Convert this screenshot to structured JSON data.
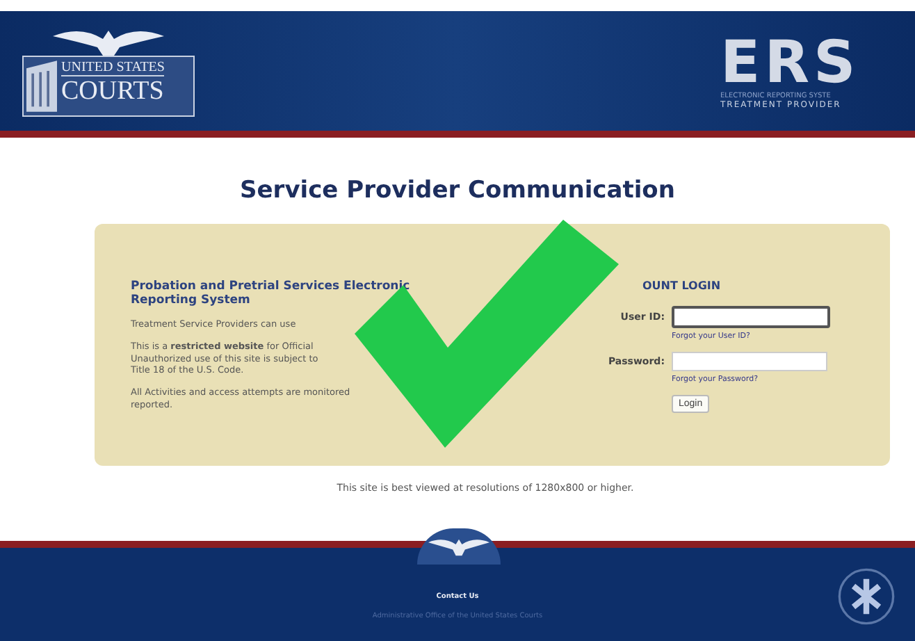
{
  "header": {
    "courts_logo": {
      "line_1": "UNITED STATES",
      "line_2": "COURTS"
    },
    "ers_logo": {
      "mark": "ERS",
      "subtitle_1": "ELECTRONIC REPORTING SYSTE",
      "subtitle_2": "TREATMENT PROVIDER"
    }
  },
  "title": "Service Provider Communication",
  "info": {
    "heading": "Probation and Pretrial Services Electronic Reporting System",
    "paragraphs": [
      {
        "lines": [
          "Treatment Service Providers can use"
        ]
      },
      {
        "lines": [
          "This is a **restricted website** for Official",
          "Unauthorized use of this site is subject to",
          "Title 18 of the U.S. Code."
        ]
      },
      {
        "lines": [
          "All Activities and access attempts are monitored",
          "reported."
        ]
      }
    ]
  },
  "login": {
    "heading": "OUNT LOGIN",
    "user_id": {
      "label": "User ID:",
      "focused": true
    },
    "forgot_user": "Forgot your User ID?",
    "password": {
      "label": "Password:",
      "focused": false
    },
    "forgot_password": "Forgot your Password?",
    "button": "Login"
  },
  "resolution_note": "This site is best viewed at resolutions of 1280x800 or higher.",
  "footer": {
    "contact": "Contact Us",
    "agency": "Administrative Office of the United States Courts"
  },
  "overlay": {
    "kind": "checkmark"
  }
}
